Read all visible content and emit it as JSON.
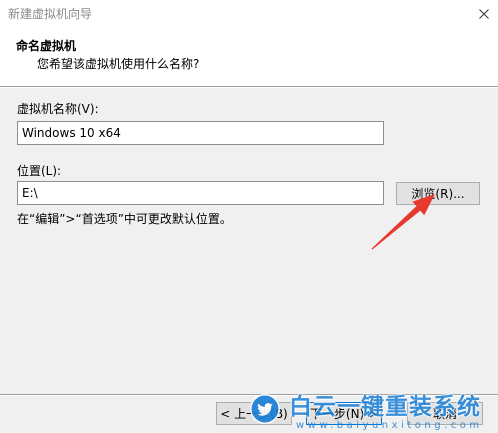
{
  "window": {
    "title": "新建虚拟机向导",
    "close_icon": "close-icon"
  },
  "header": {
    "title": "命名虚拟机",
    "subtitle": "您希望该虚拟机使用什么名称?"
  },
  "form": {
    "name_label": "虚拟机名称(V):",
    "name_value": "Windows 10 x64",
    "location_label": "位置(L):",
    "location_value": "E:\\",
    "browse_label": "浏览(R)...",
    "hint": "在“编辑”>“首选项”中可更改默认位置。"
  },
  "footer": {
    "back_label": "< 上一步(B)",
    "next_label": "下一步(N) >",
    "cancel_label": "取消"
  },
  "watermark": {
    "logo_icon": "bird-icon",
    "brand": "白云一键重装系统",
    "url": "www.baiyunxitong.com",
    "color": "#1b7fd6"
  },
  "annotation": {
    "arrow_icon": "arrow-icon",
    "arrow_color": "#e8392f"
  },
  "colors": {
    "window_background": "#f0f0f0",
    "header_background": "#ffffff",
    "button_face": "#e1e1e1",
    "button_border": "#adadad",
    "default_button_border": "#0078d7"
  }
}
